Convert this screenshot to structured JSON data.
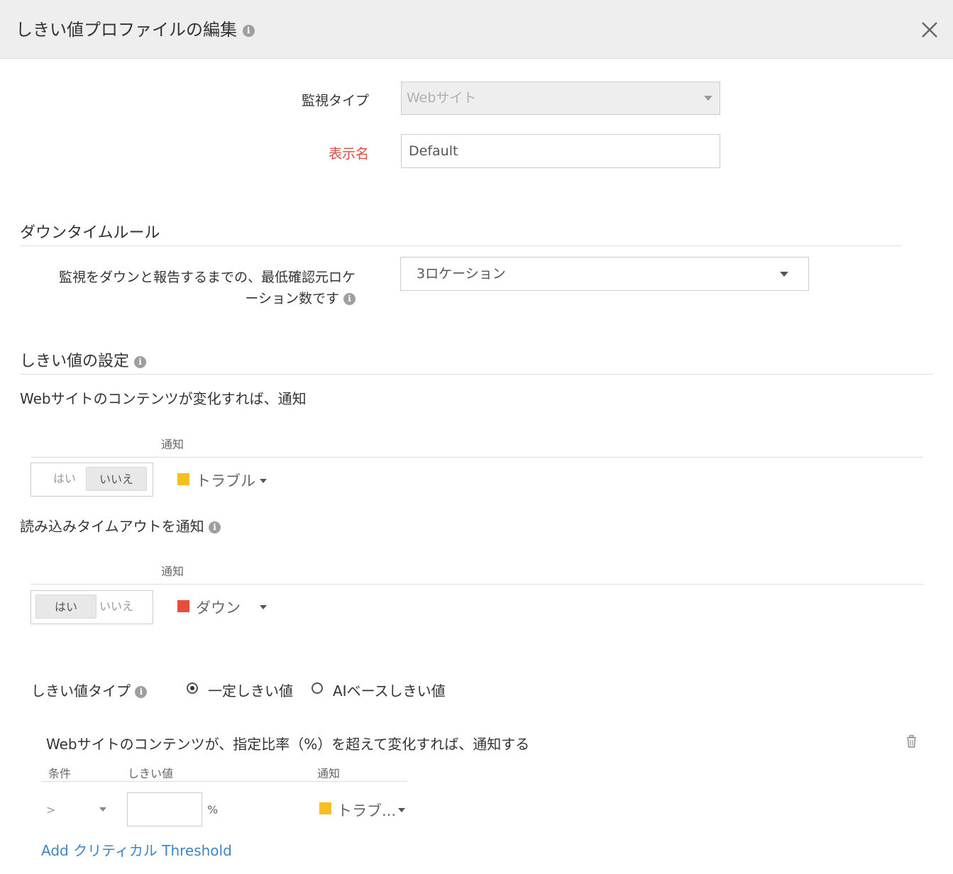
{
  "dialog": {
    "title": "しきい値プロファイルの編集",
    "info_icon": "i"
  },
  "form": {
    "monitor_type": {
      "label": "監視タイプ",
      "value": "Webサイト"
    },
    "display_name": {
      "label": "表示名",
      "value": "Default"
    }
  },
  "downtime": {
    "title": "ダウンタイムルール",
    "min_locations_label_line1": "監視をダウンと報告するまでの、最低確認元ロケ",
    "min_locations_label_line2": "ーション数です",
    "min_locations_value": "3ロケーション"
  },
  "threshold": {
    "title": "しきい値の設定",
    "content_change": {
      "title": "Webサイトのコンテンツが変化すれば、通知",
      "notify_header": "通知",
      "toggle": {
        "yes": "はい",
        "no": "いいえ",
        "selected": "no"
      },
      "severity": "トラブル",
      "severity_color": "#f5c021"
    },
    "read_timeout": {
      "title": "読み込みタイムアウトを通知",
      "notify_header": "通知",
      "toggle": {
        "yes": "はい",
        "no": "いいえ",
        "selected": "yes"
      },
      "severity": "ダウン",
      "severity_color": "#e74c3c"
    },
    "type": {
      "label": "しきい値タイプ",
      "options": [
        "一定しきい値",
        "AIベースしきい値"
      ],
      "selected": "一定しきい値"
    },
    "percent_rule": {
      "title": "Webサイトのコンテンツが、指定比率（%）を超えて変化すれば、通知する",
      "col_condition": "条件",
      "col_threshold": "しきい値",
      "col_notify": "通知",
      "condition": ">",
      "threshold_value": "",
      "unit": "%",
      "severity": "トラブ...",
      "severity_color": "#f5c021"
    },
    "add_critical_link": "Add クリティカル Threshold"
  },
  "icons": {
    "close": "close-icon",
    "info": "info-icon",
    "trash": "trash-icon",
    "caret": "caret-down-icon"
  }
}
